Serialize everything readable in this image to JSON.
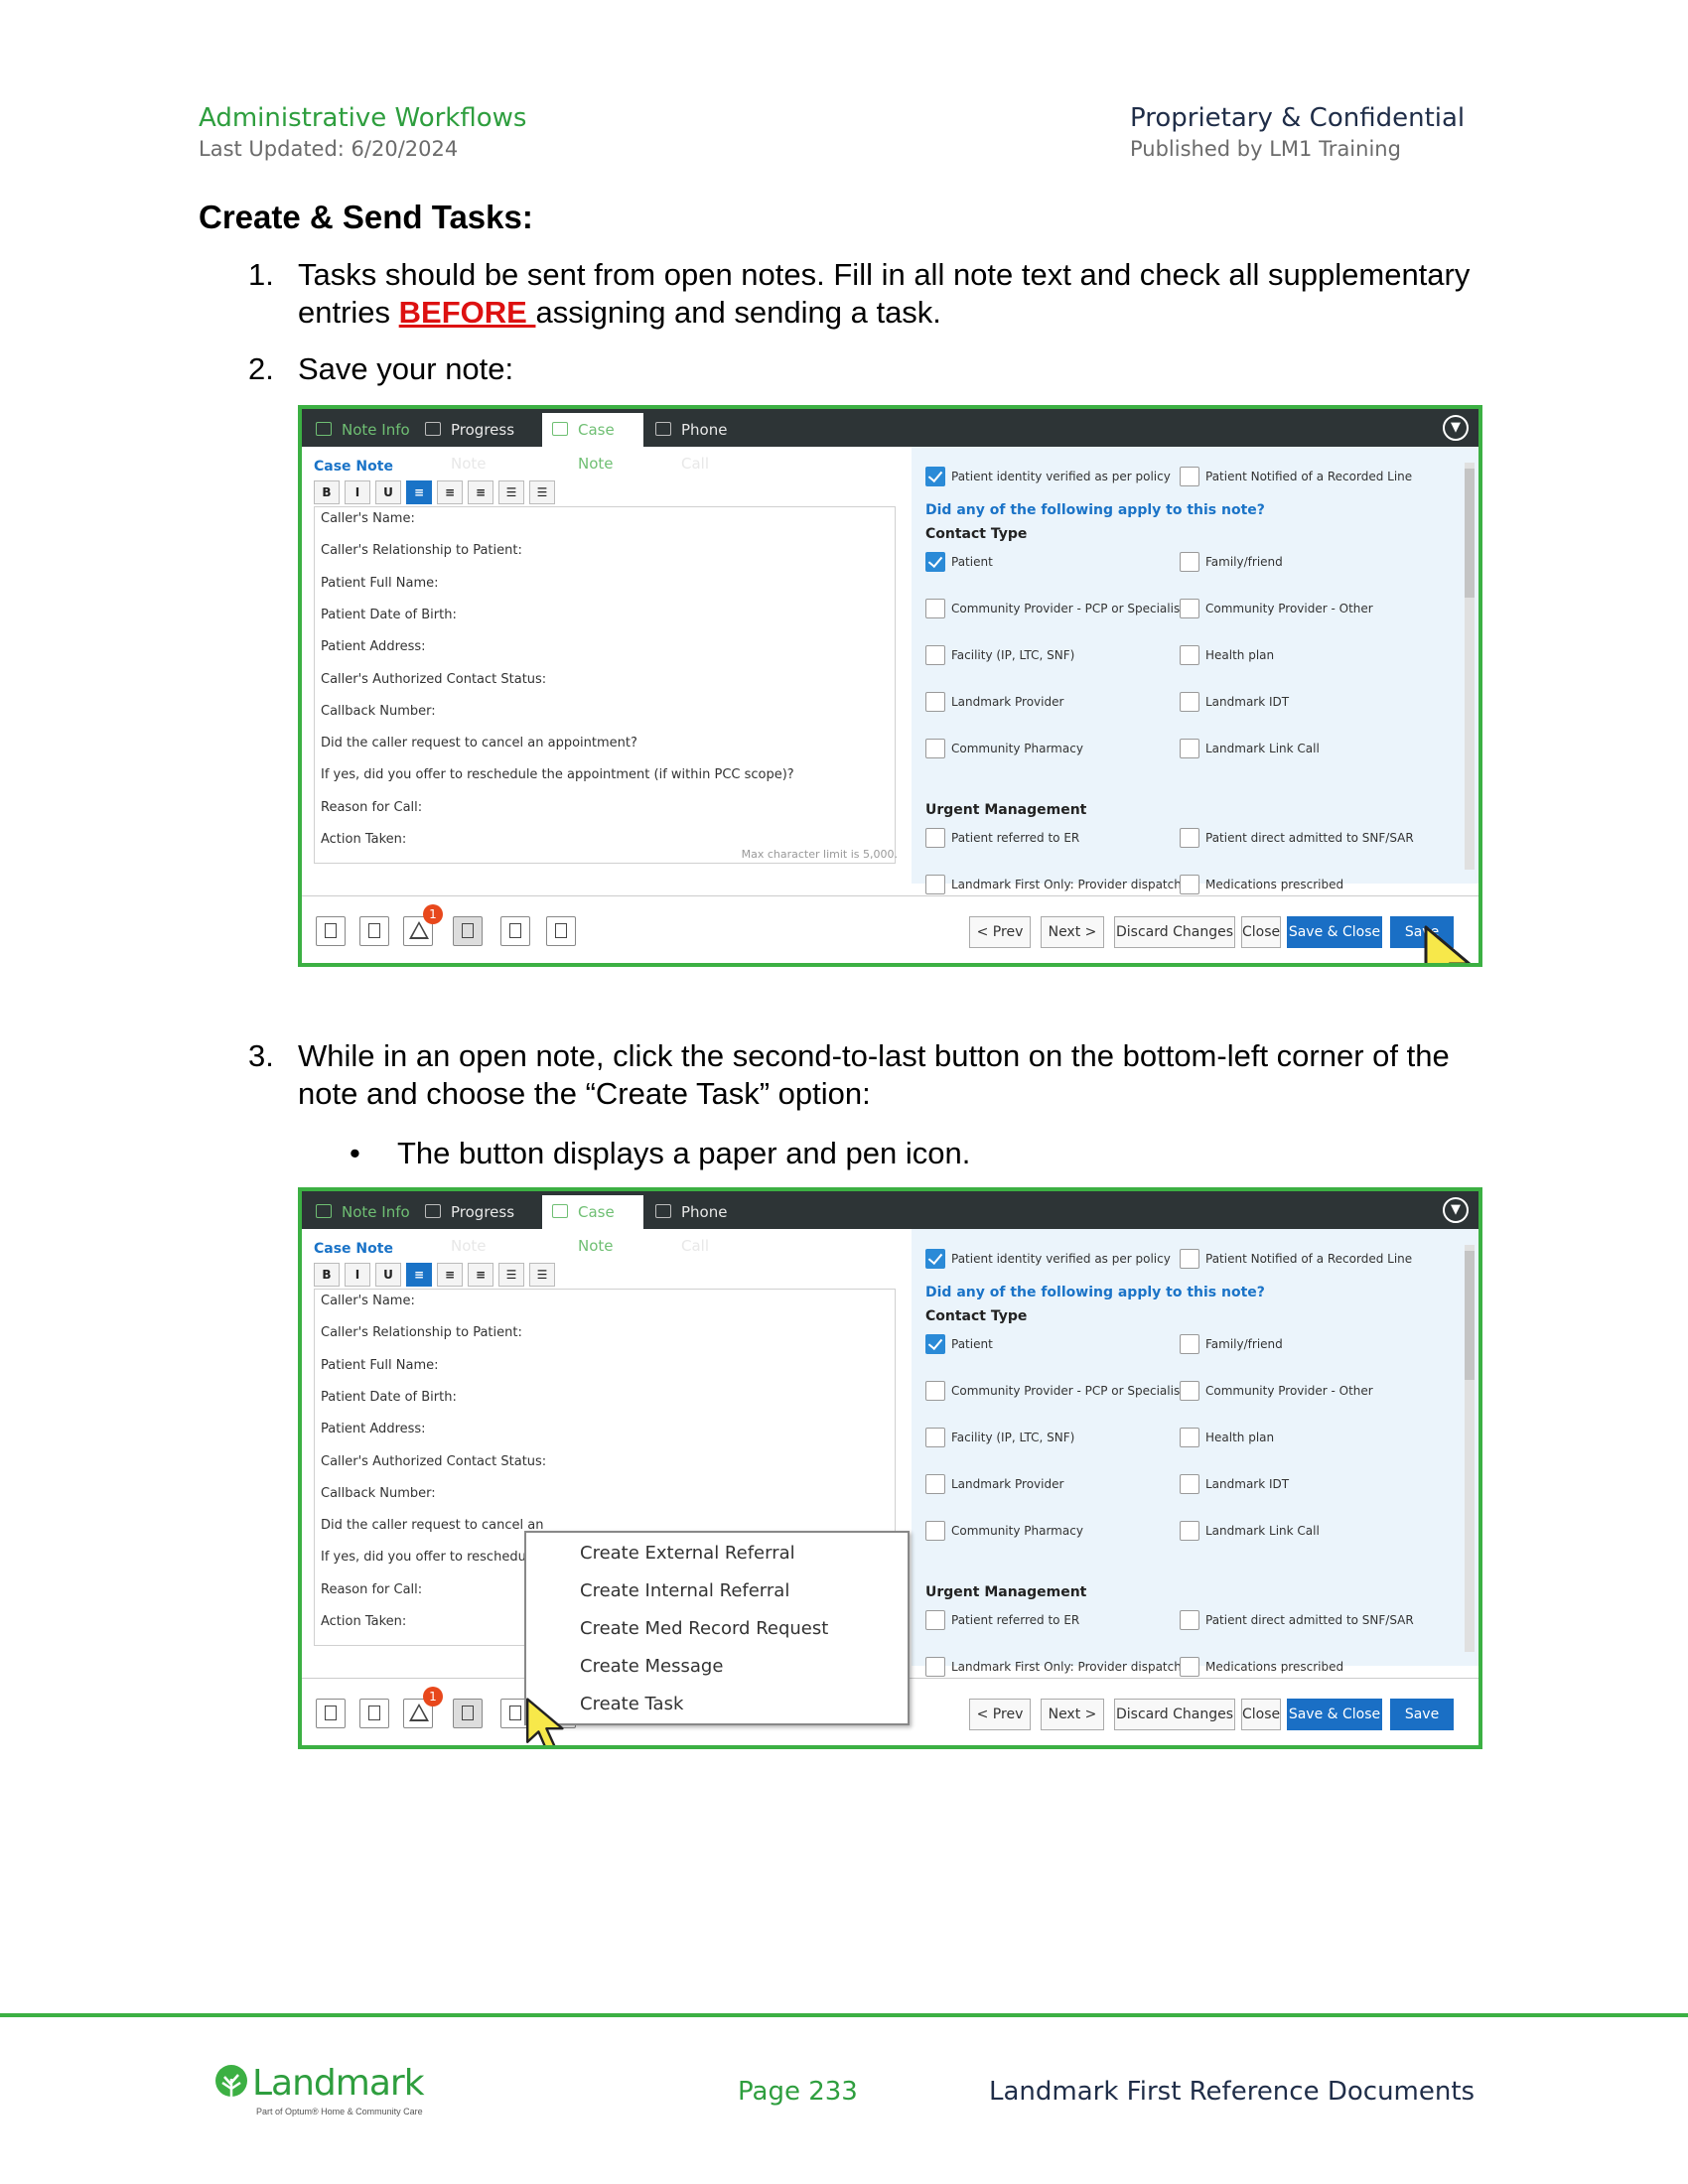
{
  "header": {
    "left_title": "Administrative Workflows",
    "left_sub": "Last Updated: 6/20/2024",
    "right_title": "Proprietary & Confidential",
    "right_sub": "Published by LM1 Training"
  },
  "section_title": "Create & Send Tasks:",
  "steps": [
    {
      "num": "1.",
      "text_a": "Tasks should be sent from open notes. Fill in all note text and check all supplementary entries ",
      "emph": "BEFORE ",
      "text_b": "assigning and sending a task."
    },
    {
      "num": "2.",
      "text": "Save your note:"
    },
    {
      "num": "3.",
      "text": "While in an open note, click the second-to-last button on the bottom-left corner of the note and choose the “Create Task” option:"
    }
  ],
  "bullet": {
    "symbol": "•",
    "text": "The button displays a paper and pen icon."
  },
  "note_ui": {
    "tabs": [
      "Note Info",
      "Progress Note",
      "Case Note",
      "Phone Call"
    ],
    "collapse_icon": "chevron-down-circle-icon",
    "pane_title": "Case Note",
    "format_buttons": [
      "B",
      "I",
      "U",
      "≡",
      "≡",
      "≡",
      "☰",
      "☰"
    ],
    "fields": [
      "Caller's Name:",
      "Caller's Relationship to Patient:",
      "Patient Full Name:",
      "Patient Date of Birth:",
      "Patient Address:",
      "Caller's Authorized Contact Status:",
      "Callback Number:",
      "Did the caller request to cancel an appointment?",
      "If yes, did you offer to reschedule the appointment (if within PCC scope)?",
      "Reason for Call:",
      "Action Taken:"
    ],
    "fields_truncated_7": "Did the caller request to cancel an",
    "fields_truncated_8": "If yes, did you offer to reschedule t",
    "max_char": "Max character limit is 5,000.",
    "verify": [
      {
        "label": "Patient identity verified as per policy",
        "checked": true
      },
      {
        "label": "Patient Notified of a Recorded Line",
        "checked": false
      }
    ],
    "question": "Did any of the following apply to this note?",
    "contact_type_heading": "Contact Type",
    "contact_types": [
      {
        "label": "Patient",
        "checked": true
      },
      {
        "label": "Family/friend",
        "checked": false
      },
      {
        "label": "Community Provider - PCP or Specialist",
        "checked": false
      },
      {
        "label": "Community Provider - Other",
        "checked": false
      },
      {
        "label": "Facility (IP, LTC, SNF)",
        "checked": false
      },
      {
        "label": "Health plan",
        "checked": false
      },
      {
        "label": "Landmark Provider",
        "checked": false
      },
      {
        "label": "Landmark IDT",
        "checked": false
      },
      {
        "label": "Community Pharmacy",
        "checked": false
      },
      {
        "label": "Landmark Link Call",
        "checked": false
      }
    ],
    "urgent_heading": "Urgent Management",
    "urgent": [
      {
        "label": "Patient referred to ER",
        "checked": false
      },
      {
        "label": "Patient direct admitted to SNF/SAR",
        "checked": false
      },
      {
        "label": "Landmark First Only: Provider dispatched",
        "checked": false
      },
      {
        "label": "Medications prescribed",
        "checked": false
      }
    ],
    "alert_badge": "1",
    "buttons": {
      "prev": "< Prev",
      "next": "Next >",
      "discard": "Discard Changes",
      "close": "Close",
      "save_close": "Save & Close",
      "save": "Save"
    }
  },
  "context_menu": [
    "Create External Referral",
    "Create Internal Referral",
    "Create Med Record Request",
    "Create Message",
    "Create Task"
  ],
  "footer": {
    "logo_text": "Landmark",
    "logo_sub": "Part of Optum® Home & Community Care",
    "page": "Page 233",
    "right": "Landmark First Reference Documents"
  }
}
